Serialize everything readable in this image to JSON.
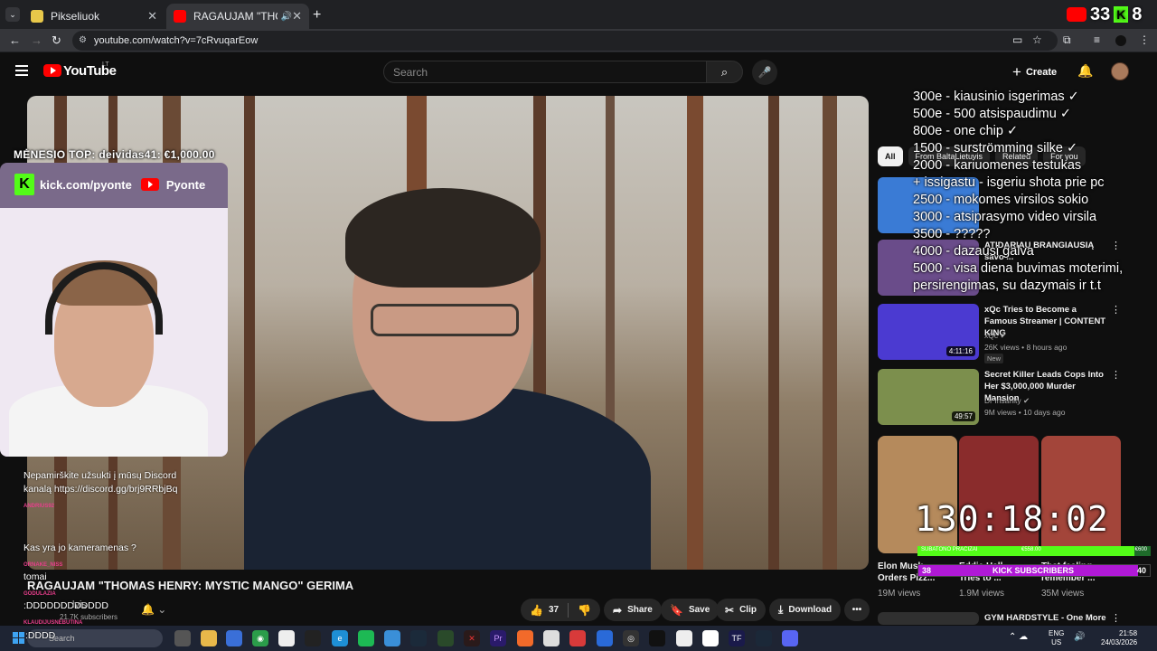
{
  "browser": {
    "tabs": [
      {
        "title": "Pikseliuok",
        "close": "✕"
      },
      {
        "title": "RAGAUJAM \"THOMAS HEN",
        "close": "✕"
      }
    ],
    "new_tab": "+",
    "url": "youtube.com/watch?v=7cRvuqarEow"
  },
  "extension_badge": {
    "yt_count": "33",
    "kick_count": "8"
  },
  "masthead": {
    "logo_text": "YouTube",
    "country": "LT",
    "search_placeholder": "Search",
    "create_label": "Create"
  },
  "video": {
    "title": "RAGAUJAM \"THOMAS HENRY: MYSTIC MANGO\" GERIMA",
    "channel": "lvis",
    "subscribers": "21.7K subscribers",
    "likes": "37",
    "share_label": "Share",
    "save_label": "Save",
    "clip_label": "Clip",
    "download_label": "Download"
  },
  "stream_overlay": {
    "top_donor": "MĖNESIO TOP: deividas41: €1,000.00",
    "kick_url": "kick.com/pyonte",
    "yt_name": "Pyonte"
  },
  "chat": [
    {
      "name": "",
      "text": "Nepamirškite užsukti į mūsų Discord kanalą https://discord.gg/brj9RRbjBq"
    },
    {
      "name": "ANDRIUS92",
      "text": ""
    },
    {
      "name": "",
      "text": "Kas yra jo kameramenas ?"
    },
    {
      "name": "ORNAKE_NISS",
      "text": "tomai"
    },
    {
      "name": "GODULAZIA",
      "text": ":DDDDDDDDDDDD"
    },
    {
      "name": "KLAUDIJUSNEBUTINA",
      "text": ":DDDD"
    }
  ],
  "chips": [
    "All",
    "From BaltaLietuvis",
    "Related",
    "For you"
  ],
  "recommendations": [
    {
      "title": "ATIDARIAU BRANGIAUSIĄ savo ...",
      "channel": "",
      "stats": "",
      "duration": "",
      "new": true,
      "thumb_color": "#6a4c8a"
    },
    {
      "title": "xQc Tries to Become a Famous Streamer | CONTENT KING",
      "channel": "xQc",
      "stats": "26K views • 8 hours ago",
      "duration": "4:11:16",
      "new": true,
      "thumb_color": "#4b3ad1"
    },
    {
      "title": "Secret Killer Leads Cops Into Her $3,000,000 Murder Mansion",
      "channel": "Dr Insanity",
      "stats": "9M views • 10 days ago",
      "duration": "49:57",
      "new": false,
      "thumb_color": "#7c8f4d"
    },
    {
      "title": "GYM HARDSTYLE - One More",
      "channel": "",
      "stats": "",
      "duration": "",
      "new": false,
      "thumb_color": "#303030"
    }
  ],
  "shorts": [
    {
      "title": "Elon Musk Orders Pizz...",
      "views": "19M views",
      "color": "#b58a5c"
    },
    {
      "title": "Eddie Hall ... Tries to ...",
      "views": "1.9M views",
      "color": "#8a2c2c"
    },
    {
      "title": "That feeling remember ...",
      "views": "35M views",
      "color": "#a3453a"
    }
  ],
  "goals": [
    "300e - kiausinio isgerimas ✓",
    "500e - 500 atsispaudimu ✓",
    "800e - one chip ✓",
    "1500 - surströmming silke ✓",
    "2000 - kariuomenes testukas",
    "+ issigastu - isgeriu shota prie pc",
    "2500 - mokomes virsilos sokio",
    "3000 - atsiprasymo video virsila",
    "3500 - ?????",
    "4000 - dazausi galva",
    "5000 - visa diena buvimas moterimi,",
    "persirengimas, su dazymais ir t.t"
  ],
  "timer": "130:18:02",
  "goal_bar": {
    "left": "SUBATONO PRACIZAI",
    "mid": "€558.00",
    "right": "€600",
    "progress": 0.93
  },
  "subs_bar": {
    "count": "38",
    "label": "KICK SUBSCRIBERS",
    "target": "40",
    "progress": 0.95
  },
  "taskbar": {
    "search_placeholder": "Search",
    "lang": "ENG",
    "region": "US",
    "time": "21:58",
    "date": "24/03/2026"
  },
  "colors": {
    "yt_red": "#ff0000",
    "kick_green": "#53fc18",
    "subs_purple": "#b019d6"
  }
}
